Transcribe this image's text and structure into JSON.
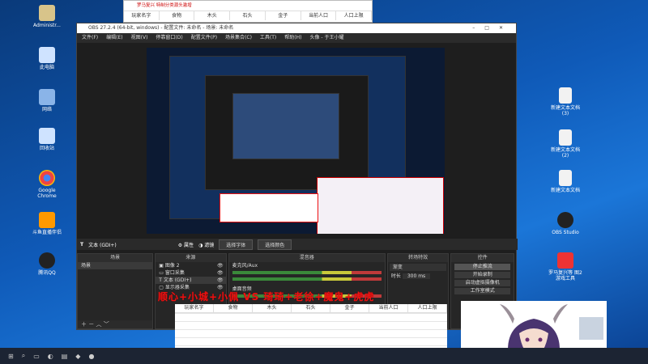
{
  "desktop": {
    "left_icons": [
      {
        "label": "Administr...",
        "color": "#d8c48a"
      },
      {
        "label": "此电脑",
        "color": "#cfe3ff"
      },
      {
        "label": "网络",
        "color": "#8ab4e8"
      },
      {
        "label": "回收站",
        "color": "#cfe3ff"
      },
      {
        "label": "Google Chrome",
        "color": "#e44"
      },
      {
        "label": "斗鱼直播伴侣",
        "color": "#f90"
      },
      {
        "label": "腾讯QQ",
        "color": "#222"
      }
    ],
    "right_icons": [
      {
        "label": "新建文本文档 (3)",
        "color": "#f2f2f2"
      },
      {
        "label": "新建文本文档 (2)",
        "color": "#f2f2f2"
      },
      {
        "label": "新建文本文档",
        "color": "#f2f2f2"
      },
      {
        "label": "OBS Studio",
        "color": "#222"
      },
      {
        "label": "罗马复兴等 图2游戏工具",
        "color": "#e33"
      }
    ]
  },
  "game_panel": {
    "title": "罗马复兴 特制分类源头激增",
    "columns": [
      "玩家名字",
      "食物",
      "木头",
      "石头",
      "金子",
      "当前人口",
      "人口上限"
    ]
  },
  "obs": {
    "title": "OBS 27.2.4 (64-bit, windows) - 配置文件: 未命名 - 场景: 未命名",
    "menu": [
      "文件(F)",
      "编辑(E)",
      "视图(V)",
      "停靠窗口(D)",
      "配置文件(P)",
      "场景集合(C)",
      "工具(T)",
      "帮助(H)",
      "头像 - 于王小耀"
    ],
    "toolbar": {
      "source_name": "文本 (GDI+)",
      "props": "属性",
      "filter": "滤镜",
      "select_font": "选择字体",
      "select_color": "选择颜色"
    },
    "docks": {
      "scenes": {
        "header": "场景",
        "items": [
          "场景"
        ]
      },
      "sources": {
        "header": "来源",
        "items": [
          "图像 2",
          "窗口采集",
          "文本 (GDI+)",
          "显示器采集"
        ]
      },
      "mixer": {
        "header": "混音器",
        "tracks": [
          "麦克风/Aux",
          "桌面音频"
        ]
      },
      "transitions": {
        "header": "转场特效",
        "type": "渐变",
        "duration_label": "时长",
        "duration": "300 ms"
      },
      "controls": {
        "header": "控件",
        "buttons": [
          "停止推流",
          "开始录制",
          "启动虚拟摄像机",
          "工作室模式"
        ]
      }
    }
  },
  "banner": "顺心+小城+小佩 VS 琦琦+老徐+魔鬼+虎虎",
  "sheet": {
    "columns": [
      "玩家名字",
      "食物",
      "木头",
      "石头",
      "金子",
      "当前人口",
      "人口上限"
    ]
  }
}
